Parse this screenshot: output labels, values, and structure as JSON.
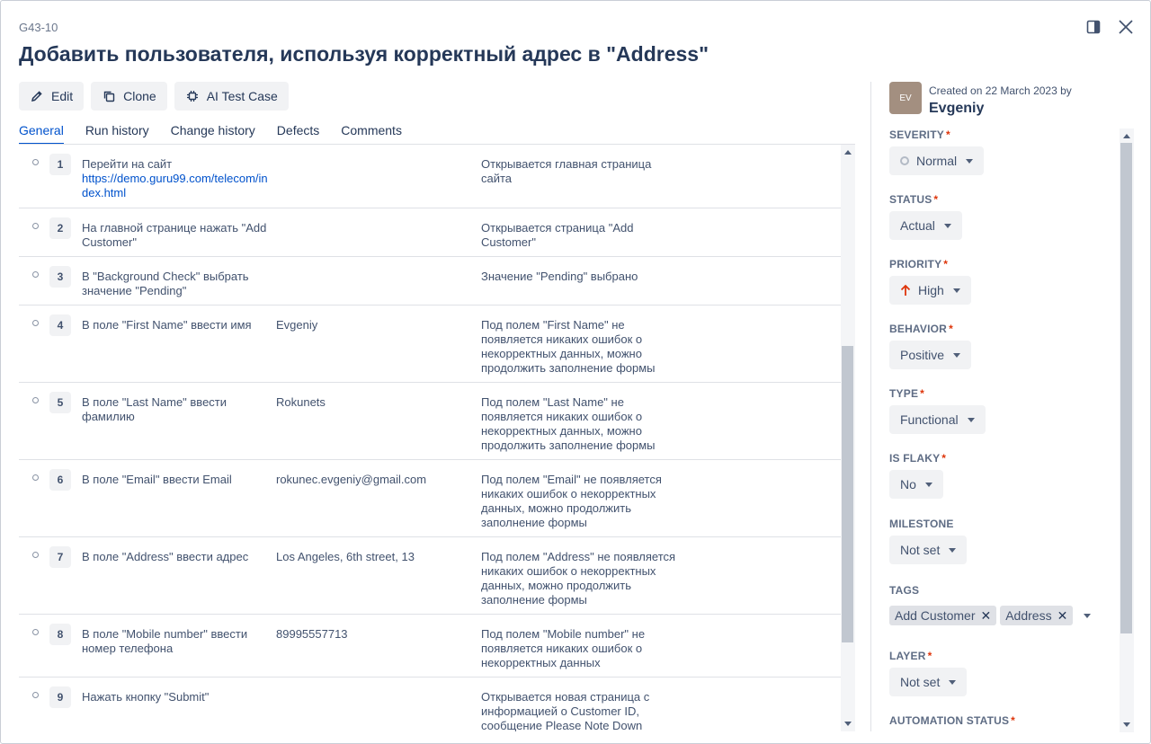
{
  "case": {
    "id": "G43-10",
    "title": "Добавить пользователя, используя корректный адрес в \"Address\""
  },
  "header_icons": [
    "sidebar-toggle-icon",
    "close-icon"
  ],
  "actions": {
    "edit": "Edit",
    "clone": "Clone",
    "ai": "AI Test Case"
  },
  "tabs": [
    "General",
    "Run history",
    "Change history",
    "Defects",
    "Comments"
  ],
  "steps": [
    {
      "num": "1",
      "action": "Перейти на сайт",
      "link": "https://demo.guru99.com/telecom/index.html",
      "data": "",
      "expected": "Открывается главная страница сайта"
    },
    {
      "num": "2",
      "action": "На главной странице нажать \"Add Customer\"",
      "link": "",
      "data": "",
      "expected": "Открывается страница \"Add Customer\""
    },
    {
      "num": "3",
      "action": "В \"Background Check\" выбрать значение \"Pending\"",
      "link": "",
      "data": "",
      "expected": "Значение \"Pending\" выбрано"
    },
    {
      "num": "4",
      "action": "В поле \"First Name\" ввести имя",
      "link": "",
      "data": "Evgeniy",
      "expected": "Под полем \"First Name\" не появляется никаких ошибок о некорректных данных, можно продолжить заполнение формы"
    },
    {
      "num": "5",
      "action": "В поле \"Last Name\" ввести фамилию",
      "link": "",
      "data": "Rokunets",
      "expected": "Под полем \"Last Name\" не появляется никаких ошибок о некорректных данных, можно продолжить заполнение формы"
    },
    {
      "num": "6",
      "action": "В поле \"Email\" ввести Email",
      "link": "",
      "data": "rokunec.evgeniy@gmail.com",
      "expected": "Под полем \"Email\" не появляется никаких ошибок о некорректных данных, можно продолжить заполнение формы"
    },
    {
      "num": "7",
      "action": "В поле \"Address\" ввести адрес",
      "link": "",
      "data": "Los Angeles, 6th street, 13",
      "expected": "Под полем \"Address\" не появляется никаких ошибок о некорректных данных, можно продолжить заполнение формы"
    },
    {
      "num": "8",
      "action": "В поле \"Mobile number\" ввести номер телефона",
      "link": "",
      "data": "89995557713",
      "expected": "Под полем \"Mobile number\" не появляется никаких ошибок о некорректных данных"
    },
    {
      "num": "9",
      "action": "Нажать кнопку \"Submit\"",
      "link": "",
      "data": "",
      "expected": "Открывается новая страница с информацией о Customer ID, сообщение Please Note Down"
    }
  ],
  "meta": {
    "avatar": "EV",
    "created": "Created on 22 March 2023 by",
    "author": "Evgeniy"
  },
  "fields": {
    "severity": {
      "label": "SEVERITY",
      "value": "Normal",
      "icon": "circle-icon"
    },
    "status": {
      "label": "STATUS",
      "value": "Actual"
    },
    "priority": {
      "label": "PRIORITY",
      "value": "High",
      "icon": "arrow-up-icon",
      "icon_color": "#de350b"
    },
    "behavior": {
      "label": "BEHAVIOR",
      "value": "Positive"
    },
    "type": {
      "label": "TYPE",
      "value": "Functional"
    },
    "flaky": {
      "label": "IS FLAKY",
      "value": "No"
    },
    "milestone": {
      "label": "MILESTONE",
      "value": "Not set"
    },
    "tags": {
      "label": "TAGS",
      "items": [
        "Add Customer",
        "Address"
      ]
    },
    "layer": {
      "label": "LAYER",
      "value": "Not set"
    },
    "automation": {
      "label": "AUTOMATION STATUS"
    }
  },
  "colors": {
    "accent": "#0052cc",
    "required": "#de350b"
  }
}
